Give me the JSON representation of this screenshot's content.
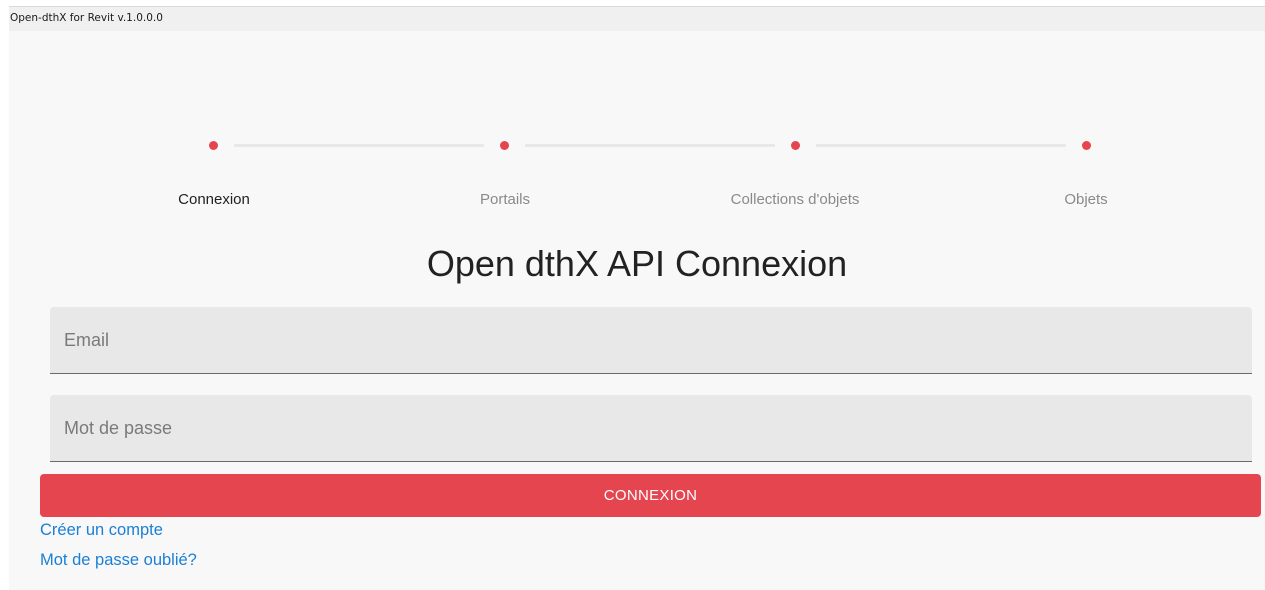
{
  "window": {
    "title": "Open-dthX for Revit v.1.0.0.0"
  },
  "stepper": {
    "steps": [
      {
        "label": "Connexion",
        "state": "active"
      },
      {
        "label": "Portails",
        "state": "inactive"
      },
      {
        "label": "Collections d'objets",
        "state": "inactive"
      },
      {
        "label": "Objets",
        "state": "inactive"
      }
    ],
    "dot_color": "#e5454f"
  },
  "main": {
    "title": "Open dthX API Connexion",
    "email_placeholder": "Email",
    "email_value": "",
    "password_placeholder": "Mot de passe",
    "password_value": "",
    "connect_label": "CONNEXION",
    "create_account_label": "Créer un compte",
    "forgot_password_label": "Mot de passe oublié?"
  },
  "colors": {
    "accent": "#e5454f",
    "link": "#1a7fd6"
  }
}
